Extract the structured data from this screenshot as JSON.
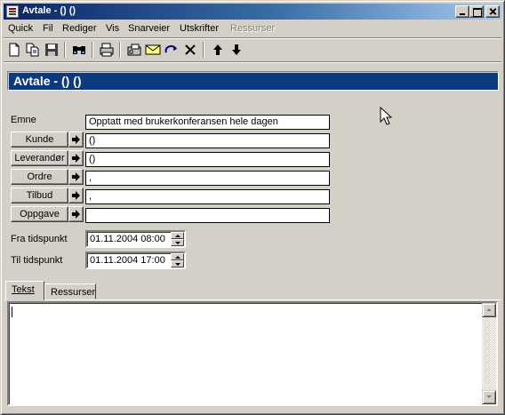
{
  "window": {
    "title": "Avtale - () ()",
    "colors": {
      "title_start": "#0a246a",
      "title_end": "#a6caf0",
      "header_bg": "#0d3a7e",
      "face": "#d4d0c8"
    }
  },
  "menu": {
    "items": [
      {
        "label": "Quick",
        "disabled": false
      },
      {
        "label": "Fil",
        "disabled": false
      },
      {
        "label": "Rediger",
        "disabled": false
      },
      {
        "label": "Vis",
        "disabled": false
      },
      {
        "label": "Snarveier",
        "disabled": false
      },
      {
        "label": "Utskrifter",
        "disabled": false
      },
      {
        "label": "Ressurser",
        "disabled": true
      }
    ]
  },
  "toolbar": {
    "icons": [
      "new-document-icon",
      "copy-icon",
      "save-icon",
      "binoculars-icon",
      "print-icon",
      "fax-icon",
      "envelope-icon",
      "redo-icon",
      "delete-icon",
      "arrow-up-icon",
      "arrow-down-icon"
    ]
  },
  "header": {
    "title": "Avtale - () ()"
  },
  "form": {
    "emne_label": "Emne",
    "emne_value": "Opptatt med brukerkonferansen hele dagen",
    "kunde_label": "Kunde",
    "kunde_value": "()",
    "leverandor_label": "Leverandør",
    "leverandor_value": "()",
    "ordre_label": "Ordre",
    "ordre_value": ",",
    "tilbud_label": "Tilbud",
    "tilbud_value": ",",
    "oppgave_label": "Oppgave",
    "oppgave_value": "",
    "fra_label": "Fra tidspunkt",
    "fra_value": "01.11.2004 08:00",
    "til_label": "Til tidspunkt",
    "til_value": "01.11.2004 17:00"
  },
  "tabs": {
    "tekst": "Tekst",
    "ressurser": "Ressurser",
    "active": "Tekst"
  },
  "text_area": {
    "value": ""
  }
}
